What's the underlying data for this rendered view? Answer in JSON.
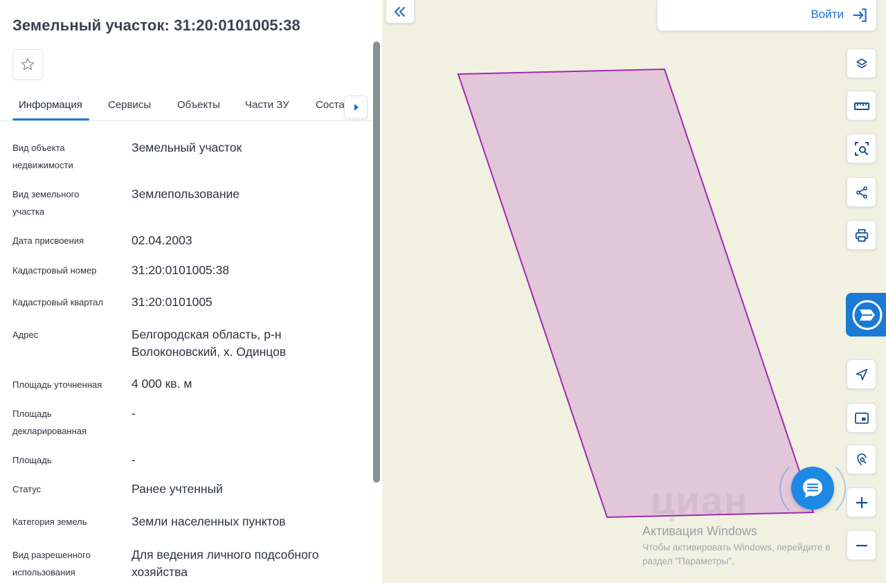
{
  "panel": {
    "title": "Земельный участок: 31:20:0101005:38",
    "tabs": [
      "Информация",
      "Сервисы",
      "Объекты",
      "Части ЗУ",
      "Соста"
    ],
    "rows": [
      {
        "label": "Вид объекта недвижимости",
        "value": "Земельный участок"
      },
      {
        "label": "Вид земельного участка",
        "value": "Землепользование"
      },
      {
        "label": "Дата присвоения",
        "value": "02.04.2003"
      },
      {
        "label": "Кадастровый номер",
        "value": "31:20:0101005:38"
      },
      {
        "label": "Кадастровый квартал",
        "value": "31:20:0101005"
      },
      {
        "label": "Адрес",
        "value": "Белгородская область, р-н Волоконовский, х. Одинцов"
      },
      {
        "label": "Площадь уточненная",
        "value": "4 000 кв. м"
      },
      {
        "label": "Площадь декларированная",
        "value": "-"
      },
      {
        "label": "Площадь",
        "value": "-"
      },
      {
        "label": "Статус",
        "value": "Ранее учтенный"
      },
      {
        "label": "Категория земель",
        "value": "Земли населенных пунктов"
      },
      {
        "label": "Вид разрешенного использования",
        "value": "Для ведения личного подсобного хозяйства"
      }
    ]
  },
  "map": {
    "login_label": "Войти",
    "tools": [
      "layers-icon",
      "ruler-icon",
      "area-select-icon",
      "share-icon",
      "print-icon",
      "navigation-icon",
      "minimap-icon",
      "location-search-icon",
      "zoom-in-icon",
      "zoom-out-icon"
    ],
    "parcel_fill": "#e2c6d9",
    "parcel_stroke": "#a12ab0",
    "map_bg": "#f1f1e2"
  },
  "overlay": {
    "watermark": "циан",
    "activation_title": "Активация Windows",
    "activation_text": "Чтобы активировать Windows, перейдите в раздел \"Параметры\"."
  },
  "colors": {
    "accent": "#1b7ad4"
  }
}
